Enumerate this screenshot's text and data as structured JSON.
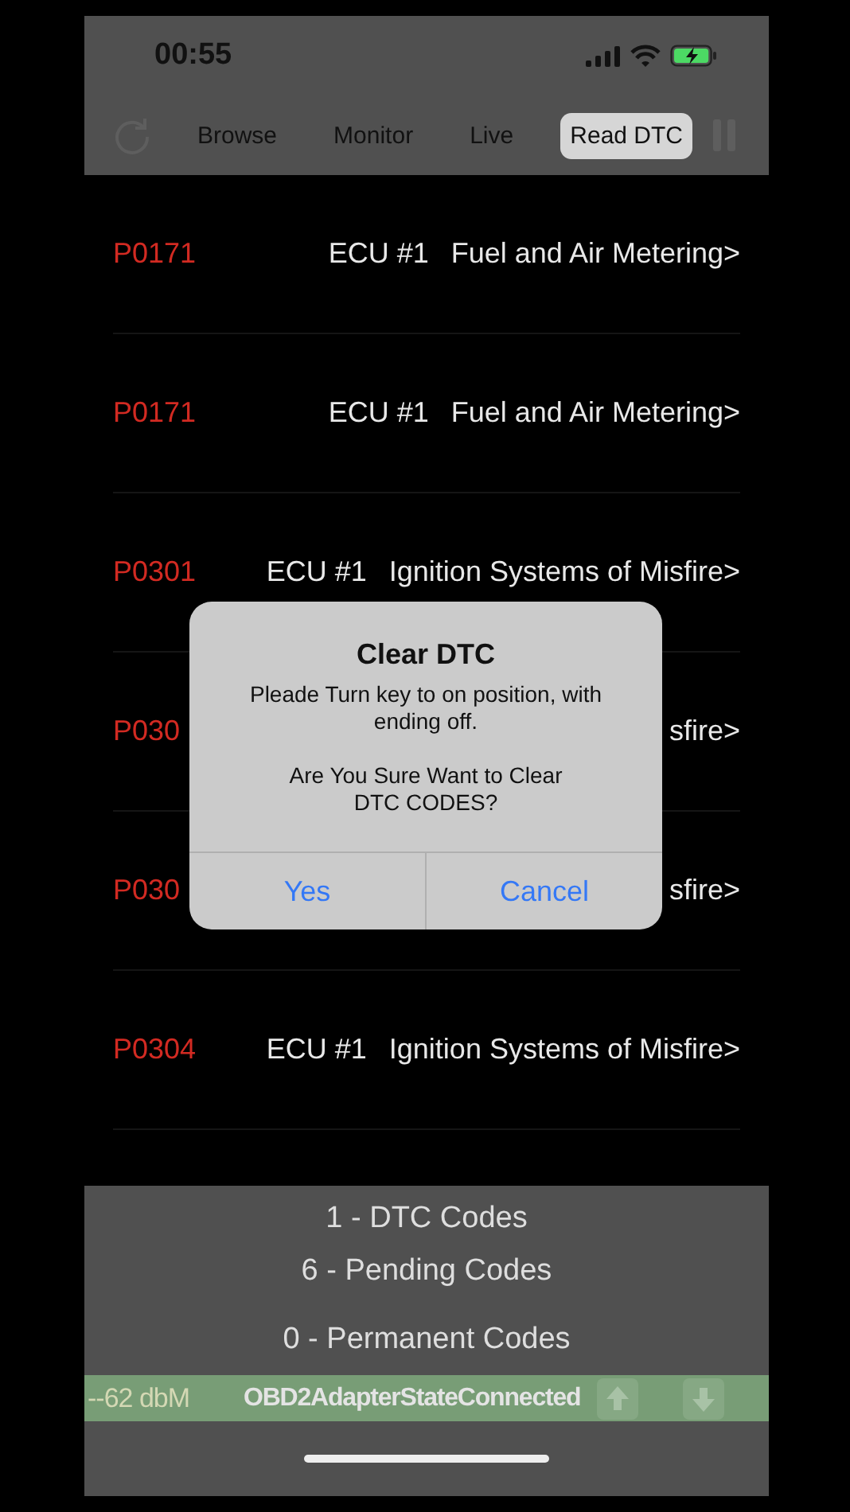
{
  "status_bar": {
    "time": "00:55"
  },
  "toolbar": {
    "tabs": [
      {
        "label": "Browse",
        "selected": false
      },
      {
        "label": "Monitor",
        "selected": false
      },
      {
        "label": "Live",
        "selected": false
      },
      {
        "label": "Read DTC",
        "selected": true
      }
    ]
  },
  "dtc_list": [
    {
      "code": "P0171",
      "ecu": "ECU #1",
      "description": "Fuel and Air Metering>"
    },
    {
      "code": "P0171",
      "ecu": "ECU #1",
      "description": "Fuel and Air Metering>"
    },
    {
      "code": "P0301",
      "ecu": "ECU #1",
      "description": "Ignition Systems of Misfire>"
    },
    {
      "code": "P030",
      "description": "sfire>"
    },
    {
      "code": "P030",
      "description": "sfire>"
    },
    {
      "code": "P0304",
      "ecu": "ECU #1",
      "description": "Ignition Systems of Misfire>"
    }
  ],
  "dialog": {
    "title": "Clear DTC",
    "message": "Pleade Turn key to on position, with\nending off.",
    "question": "Are You Sure Want to Clear\nDTC CODES?",
    "buttons": [
      "Yes",
      "Cancel"
    ]
  },
  "summary": [
    "1 - DTC Codes",
    "6 - Pending Codes",
    "0 - Permanent Codes"
  ],
  "adapter_bar": {
    "signal": "--62 dbM",
    "state": "OBD2AdapterStateConnected"
  }
}
